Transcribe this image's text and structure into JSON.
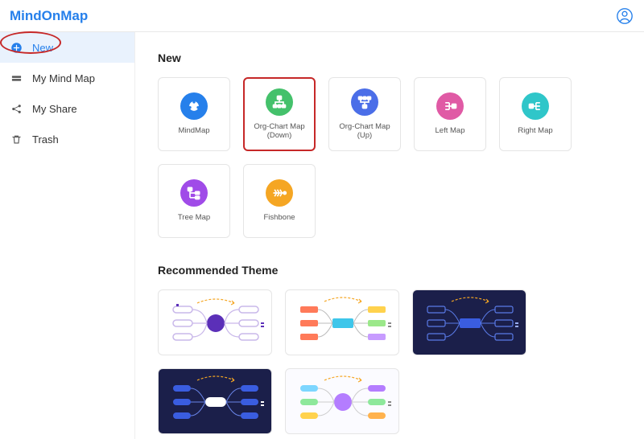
{
  "brand": {
    "name": "MindOnMap"
  },
  "sidebar": {
    "items": [
      {
        "label": "New",
        "icon": "plus-circle-icon",
        "active": true
      },
      {
        "label": "My Mind Map",
        "icon": "folder-icon",
        "active": false
      },
      {
        "label": "My Share",
        "icon": "share-icon",
        "active": false
      },
      {
        "label": "Trash",
        "icon": "trash-icon",
        "active": false
      }
    ]
  },
  "sections": {
    "new_title": "New",
    "themes_title": "Recommended Theme"
  },
  "cards": [
    {
      "label": "MindMap",
      "color": "#2680eb",
      "icon": "mindmap-icon",
      "highlighted": false
    },
    {
      "label": "Org-Chart Map (Down)",
      "color": "#44c16b",
      "icon": "orgdown-icon",
      "highlighted": true
    },
    {
      "label": "Org-Chart Map (Up)",
      "color": "#4b6ee8",
      "icon": "orgup-icon",
      "highlighted": false
    },
    {
      "label": "Left Map",
      "color": "#e05aa5",
      "icon": "leftmap-icon",
      "highlighted": false
    },
    {
      "label": "Right Map",
      "color": "#2fc6c9",
      "icon": "rightmap-icon",
      "highlighted": false
    },
    {
      "label": "Tree Map",
      "color": "#a04be8",
      "icon": "treemap-icon",
      "highlighted": false
    },
    {
      "label": "Fishbone",
      "color": "#f5a623",
      "icon": "fishbone-icon",
      "highlighted": false
    }
  ],
  "themes": [
    {
      "name": "theme-purple-light",
      "style": "light"
    },
    {
      "name": "theme-rainbow",
      "style": "light"
    },
    {
      "name": "theme-navy-blue",
      "style": "dark1"
    },
    {
      "name": "theme-navy-white",
      "style": "dark2"
    },
    {
      "name": "theme-pastel",
      "style": "light2"
    }
  ]
}
